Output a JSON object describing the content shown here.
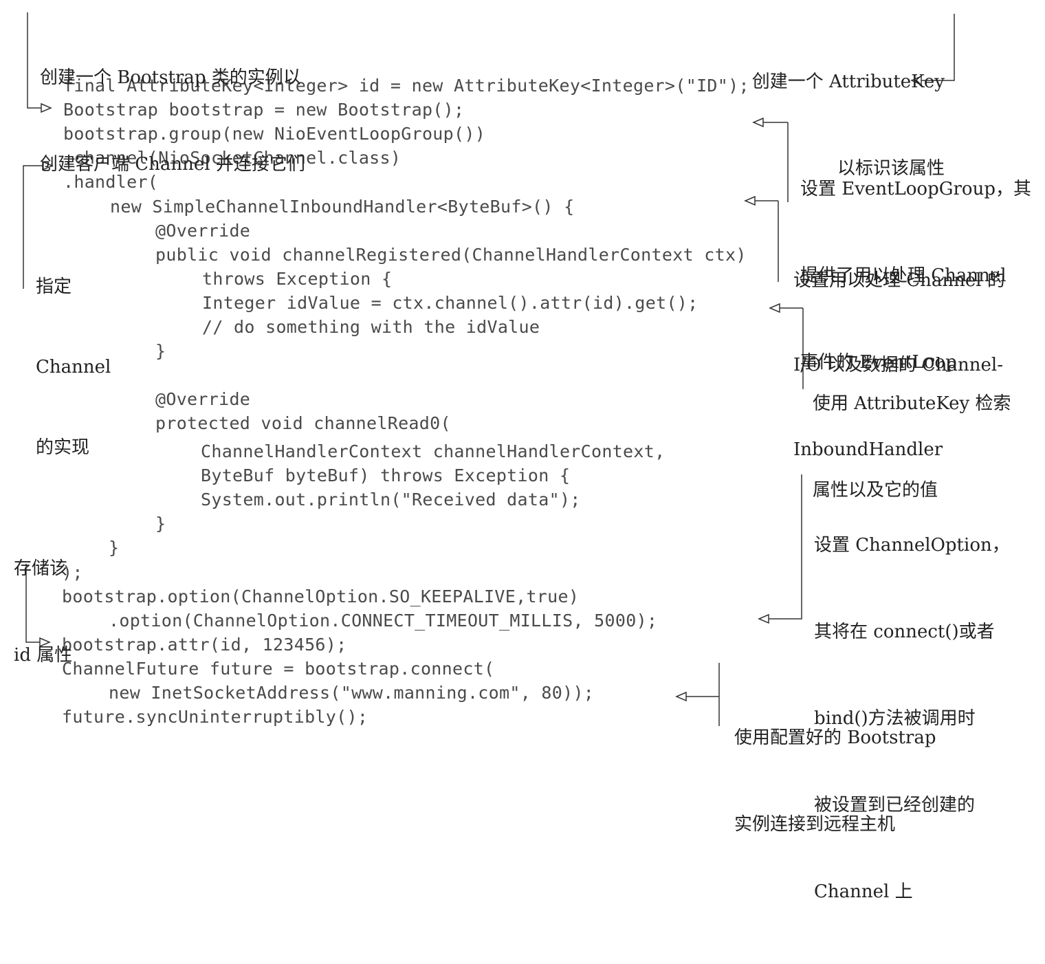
{
  "code_lines": [
    "final AttributeKey<Integer> id = new AttributeKey<Integer>(\"ID\");",
    "Bootstrap bootstrap = new Bootstrap();",
    "bootstrap.group(new NioEventLoopGroup())",
    ".channel(NioSocketChannel.class)",
    ".handler(",
    "new SimpleChannelInboundHandler<ByteBuf>() {",
    "@Override",
    "public void channelRegistered(ChannelHandlerContext ctx)",
    "throws Exception {",
    "Integer idValue = ctx.channel().attr(id).get();",
    "// do something with the idValue",
    "}",
    "@Override",
    "protected void channelRead0(",
    "ChannelHandlerContext channelHandlerContext,",
    "ByteBuf byteBuf) throws Exception {",
    "System.out.println(\"Received data\");",
    "}",
    "}",
    ");",
    "bootstrap.option(ChannelOption.SO_KEEPALIVE,true)",
    ".option(ChannelOption.CONNECT_TIMEOUT_MILLIS, 5000);",
    "bootstrap.attr(id, 123456);",
    "ChannelFuture future = bootstrap.connect(",
    "new InetSocketAddress(\"www.manning.com\", 80));",
    "future.syncUninterruptibly();"
  ],
  "annotations": {
    "create_bootstrap": [
      "创建一个 Bootstrap 类的实例以",
      "创建客户端 Channel 并连接它们"
    ],
    "create_attribute_key": [
      "创建一个 AttributeKey",
      "以标识该属性"
    ],
    "set_event_loop_group": [
      "设置 EventLoopGroup，其",
      "提供了用以处理 Channel",
      "事件的 EventLoop"
    ],
    "specify_channel_impl": [
      "指定",
      "Channel",
      "的实现"
    ],
    "set_inbound_handler": [
      "设置用以处理 Channel 的",
      "I/O 以及数据的 Channel-",
      "InboundHandler"
    ],
    "retrieve_attribute": [
      "使用 AttributeKey 检索",
      "属性以及它的值"
    ],
    "store_id_attribute": [
      "存储该",
      "id 属性"
    ],
    "set_channel_option": [
      "设置 ChannelOption，",
      "其将在 connect()或者",
      "bind()方法被调用时",
      "被设置到已经创建的",
      "Channel 上"
    ],
    "connect_remote": [
      "使用配置好的 Bootstrap",
      "实例连接到远程主机"
    ]
  }
}
